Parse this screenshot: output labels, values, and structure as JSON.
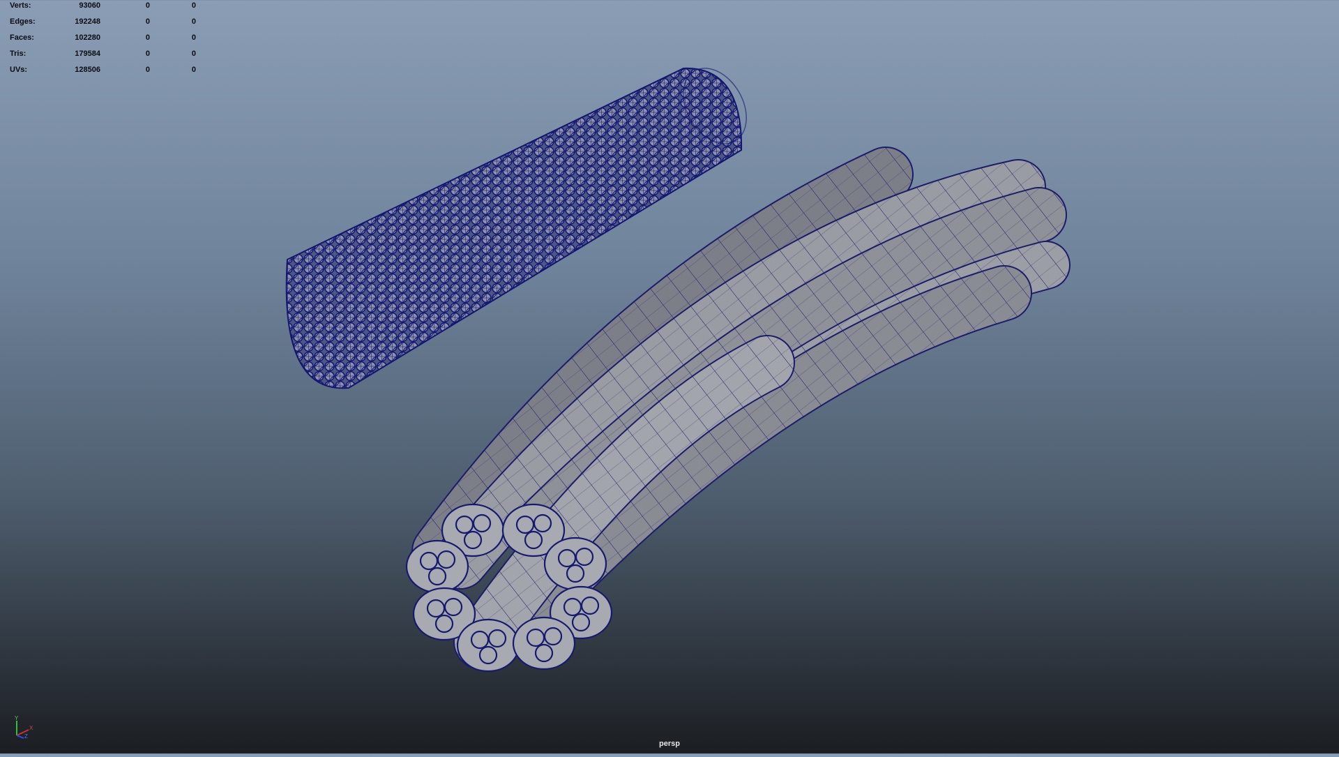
{
  "hud": {
    "rows": [
      {
        "label": "Verts:",
        "values": [
          "93060",
          "0",
          "0"
        ]
      },
      {
        "label": "Edges:",
        "values": [
          "192248",
          "0",
          "0"
        ]
      },
      {
        "label": "Faces:",
        "values": [
          "102280",
          "0",
          "0"
        ]
      },
      {
        "label": "Tris:",
        "values": [
          "179584",
          "0",
          "0"
        ]
      },
      {
        "label": "UVs:",
        "values": [
          "128506",
          "0",
          "0"
        ]
      }
    ]
  },
  "camera_label": "persp",
  "axis_gizmo": {
    "labels": [
      "Y",
      "X",
      "Z"
    ],
    "colors": {
      "x": "#d03030",
      "y": "#30c040",
      "z": "#3050e0"
    }
  },
  "colors": {
    "mesh_fill": "#8f8f94",
    "wire": "#1a1a6e",
    "selected_wire": "#161a78"
  }
}
